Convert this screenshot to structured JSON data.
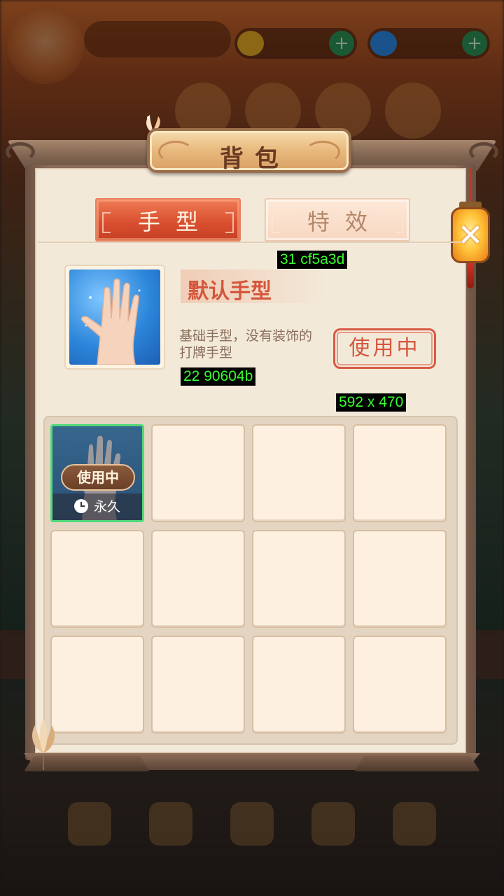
{
  "dialog": {
    "title": "背包",
    "close_icon": "close-icon"
  },
  "tabs": [
    {
      "label": "手型",
      "active": true
    },
    {
      "label": "特效",
      "active": false
    }
  ],
  "selected_item": {
    "name": "默认手型",
    "description": "基础手型，没有装饰的打牌手型",
    "use_button_label": "使用中"
  },
  "debug_labels": {
    "label_1": "31 cf5a3d",
    "label_2": "22 90604b",
    "label_3": "592 x 470"
  },
  "grid": {
    "equipped_slot": {
      "badge": "使用中",
      "duration": "永久"
    }
  },
  "colors": {
    "accent_red": "#d4563c",
    "tab_active": "#d84e2e",
    "equipped_border": "#4fd97a",
    "panel_bg": "#f3e9d9"
  }
}
